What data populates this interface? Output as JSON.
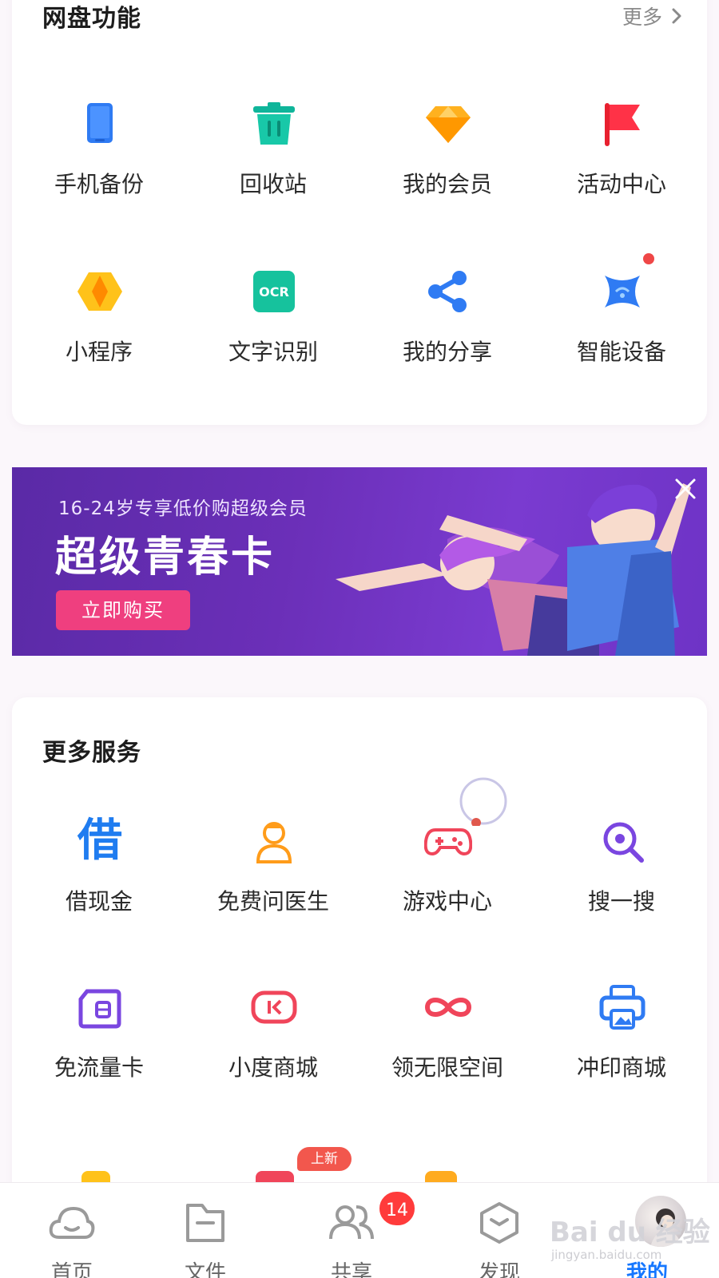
{
  "features": {
    "title": "网盘功能",
    "more_label": "更多",
    "items": [
      {
        "label": "手机备份",
        "icon": "phone-backup-icon"
      },
      {
        "label": "回收站",
        "icon": "trash-icon"
      },
      {
        "label": "我的会员",
        "icon": "diamond-icon"
      },
      {
        "label": "活动中心",
        "icon": "flag-icon"
      },
      {
        "label": "小程序",
        "icon": "mini-program-icon"
      },
      {
        "label": "文字识别",
        "icon": "ocr-icon"
      },
      {
        "label": "我的分享",
        "icon": "share-icon"
      },
      {
        "label": "智能设备",
        "icon": "smart-device-icon"
      }
    ],
    "ocr_icon_text": "OCR"
  },
  "banner": {
    "subtitle": "16-24岁专享低价购超级会员",
    "headline": "超级青春卡",
    "cta_label": "立即购买"
  },
  "services": {
    "title": "更多服务",
    "items": [
      {
        "label": "借现金",
        "icon": "loan-icon",
        "glyph": "借"
      },
      {
        "label": "免费问医生",
        "icon": "doctor-icon"
      },
      {
        "label": "游戏中心",
        "icon": "gamepad-icon"
      },
      {
        "label": "搜一搜",
        "icon": "search-icon"
      },
      {
        "label": "免流量卡",
        "icon": "sim-card-icon"
      },
      {
        "label": "小度商城",
        "icon": "xiaodu-icon"
      },
      {
        "label": "领无限空间",
        "icon": "infinity-icon"
      },
      {
        "label": "冲印商城",
        "icon": "printer-icon"
      }
    ],
    "new_tag": "上新"
  },
  "tabs": [
    {
      "label": "首页",
      "icon": "cloud-icon"
    },
    {
      "label": "文件",
      "icon": "folder-icon"
    },
    {
      "label": "共享",
      "icon": "people-icon",
      "badge": "14"
    },
    {
      "label": "发现",
      "icon": "cube-icon"
    },
    {
      "label": "我的",
      "icon": "avatar-icon",
      "active": true
    }
  ],
  "watermark": {
    "text": "Bai du 经验",
    "sub": "jingyan.baidu.com"
  },
  "colors": {
    "accent": "#1677ff",
    "banner_start": "#5a2aa6",
    "banner_end": "#7a3bd0",
    "cta": "#ef3f7f",
    "badge": "#ff3b3b"
  }
}
